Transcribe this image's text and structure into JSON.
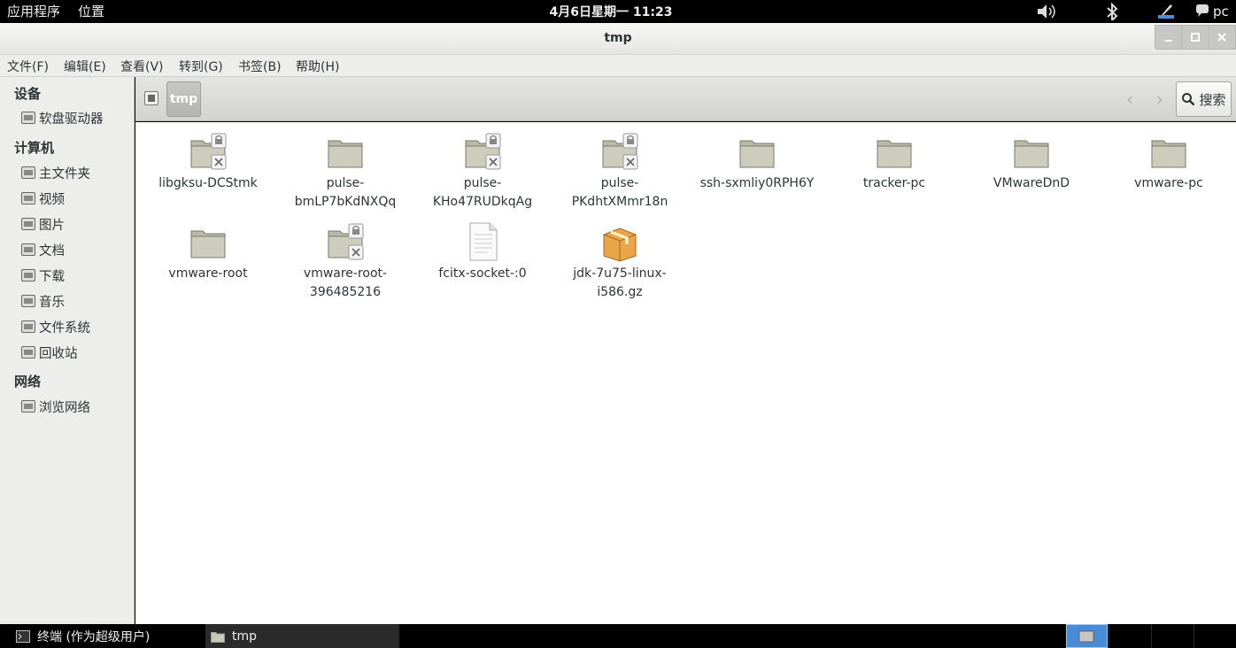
{
  "top_panel": {
    "applications": "应用程序",
    "places": "位置",
    "clock": "4月6日星期一 11:23",
    "user": "pc"
  },
  "window": {
    "title": "tmp"
  },
  "menubar": {
    "items": [
      "文件(F)",
      "编辑(E)",
      "查看(V)",
      "转到(G)",
      "书签(B)",
      "帮助(H)"
    ]
  },
  "sidebar": {
    "sections": [
      {
        "heading": "设备",
        "items": [
          "软盘驱动器"
        ]
      },
      {
        "heading": "计算机",
        "items": [
          "主文件夹",
          "视频",
          "图片",
          "文档",
          "下载",
          "音乐",
          "文件系统",
          "回收站"
        ]
      },
      {
        "heading": "网络",
        "items": [
          "浏览网络"
        ]
      }
    ]
  },
  "toolbar": {
    "path": "tmp",
    "search_label": "搜索"
  },
  "files": [
    {
      "name": "libgksu-DCStmk",
      "type": "folder-locked"
    },
    {
      "name": "pulse-bmLP7bKdNXQq",
      "type": "folder"
    },
    {
      "name": "pulse-KHo47RUDkqAg",
      "type": "folder-locked"
    },
    {
      "name": "pulse-PKdhtXMmr18n",
      "type": "folder-locked"
    },
    {
      "name": "ssh-sxmliy0RPH6Y",
      "type": "folder"
    },
    {
      "name": "tracker-pc",
      "type": "folder"
    },
    {
      "name": "VMwareDnD",
      "type": "folder"
    },
    {
      "name": "vmware-pc",
      "type": "folder"
    },
    {
      "name": "vmware-root",
      "type": "folder"
    },
    {
      "name": "vmware-root-396485216",
      "type": "folder-locked"
    },
    {
      "name": "fcitx-socket-:0",
      "type": "file"
    },
    {
      "name": "jdk-7u75-linux-i586.gz",
      "type": "archive"
    }
  ],
  "taskbar": {
    "tasks": [
      "终端 (作为超级用户)",
      "tmp"
    ]
  }
}
